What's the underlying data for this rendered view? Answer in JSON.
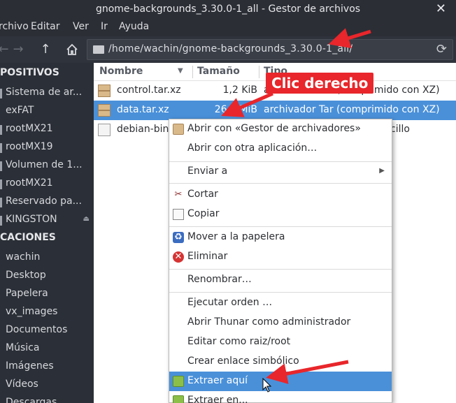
{
  "window": {
    "title": "gnome-backgrounds_3.30.0-1_all - Gestor de archivos",
    "close_glyph": "✕"
  },
  "menubar": {
    "items": [
      "rchivo",
      "Editar",
      "Ver",
      "Ir",
      "Ayuda"
    ]
  },
  "toolbar": {
    "back_icon": "arrow-left-icon",
    "forward_icon": "arrow-right-icon",
    "up_icon": "arrow-up-icon",
    "home_icon": "home-icon",
    "location": "/home/wachin/gnome-backgrounds_3.30.0-1_all/",
    "reload_icon": "reload-icon"
  },
  "sidebar": {
    "devices_heading": "POSITIVOS",
    "devices": [
      {
        "label": "Sistema de ar..."
      },
      {
        "label": "exFAT"
      },
      {
        "label": "rootMX21"
      },
      {
        "label": "rootMX19"
      },
      {
        "label": "Volumen de 1..."
      },
      {
        "label": "rootMX21"
      },
      {
        "label": "Reservado pa..."
      },
      {
        "label": "KINGSTON",
        "eject": "⏏"
      }
    ],
    "places_heading": "CACIONES",
    "places": [
      {
        "label": "wachin"
      },
      {
        "label": "Desktop"
      },
      {
        "label": "Papelera"
      },
      {
        "label": "vx_images"
      },
      {
        "label": "Documentos"
      },
      {
        "label": "Música"
      },
      {
        "label": "Imágenes"
      },
      {
        "label": "Vídeos"
      },
      {
        "label": "Descargas"
      }
    ]
  },
  "files": {
    "columns": {
      "name": "Nombre",
      "size": "Tamaño",
      "type": "Tipo"
    },
    "rows": [
      {
        "name": "control.tar.xz",
        "size": "1,2 KiB",
        "type": "archivador Tar (comprimido con XZ)",
        "icon": "archive-icon"
      },
      {
        "name": "data.tar.xz",
        "size": "26,1 MiB",
        "type": "archivador Tar (comprimido con XZ)",
        "icon": "archive-icon",
        "selected": true
      },
      {
        "name": "debian-binary",
        "size": "",
        "type": "cillo",
        "icon": "document-icon"
      }
    ]
  },
  "context_menu": {
    "open_with_archiver": "Abrir con «Gestor de archivadores»",
    "open_with_other": "Abrir con otra aplicación…",
    "send_to": "Enviar a",
    "cut": "Cortar",
    "copy": "Copiar",
    "move_to_trash": "Mover a la papelera",
    "delete": "Eliminar",
    "rename": "Renombrar…",
    "run_command": "Ejecutar orden …",
    "open_thunar_admin": "Abrir Thunar como administrador",
    "edit_as_root": "Editar como raiz/root",
    "create_symlink": "Crear enlace simbólico",
    "extract_here": "Extraer aquí",
    "extract_to": "Extraer en..."
  },
  "annotations": {
    "label": "Clic derecho",
    "color": "#e8262b"
  },
  "colors": {
    "selection": "#4a90d9",
    "dark_bg": "#2b2f37"
  }
}
